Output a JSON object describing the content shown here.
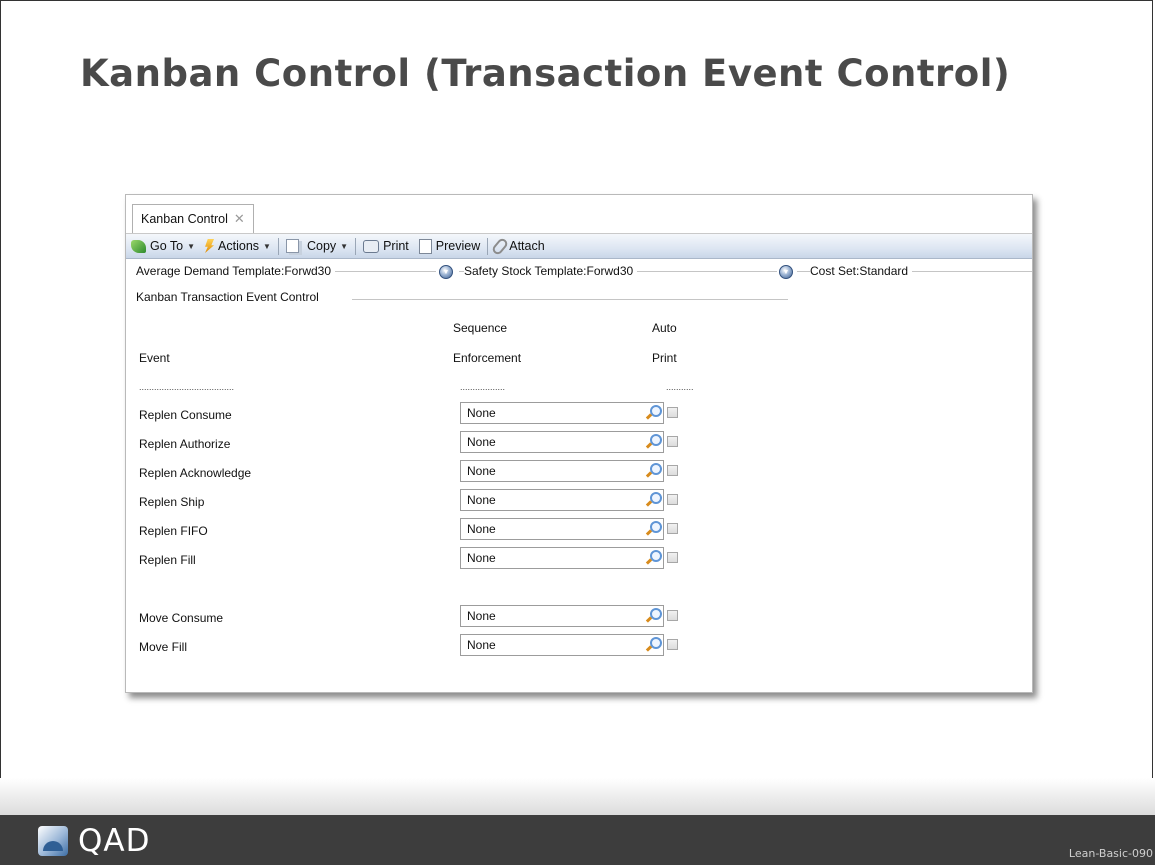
{
  "slide": {
    "title": "Kanban Control (Transaction Event Control)",
    "logo_text": "QAD",
    "slide_code": "Lean-Basic-090"
  },
  "window": {
    "tab_label": "Kanban Control",
    "tab_close_icon": "close-icon"
  },
  "toolbar": {
    "goto_label": "Go To",
    "actions_label": "Actions",
    "copy_label": "Copy",
    "print_label": "Print",
    "preview_label": "Preview",
    "attach_label": "Attach"
  },
  "header_groups": {
    "average_demand": "Average Demand Template:Forwd30",
    "safety_stock": "Safety Stock Template:Forwd30",
    "cost_set": "Cost Set:Standard"
  },
  "section": {
    "title": "Kanban Transaction Event Control"
  },
  "columns": {
    "event": "Event",
    "sequence_line1": "Sequence",
    "sequence_line2": "Enforcement",
    "auto_line1": "Auto",
    "auto_line2": "Print",
    "event_dots": "......................................",
    "sequence_dots": "..................",
    "auto_dots": "..........."
  },
  "rows": [
    {
      "label": "Replen Consume",
      "value": "None",
      "auto_print": false
    },
    {
      "label": "Replen Authorize",
      "value": "None",
      "auto_print": false
    },
    {
      "label": "Replen Acknowledge",
      "value": "None",
      "auto_print": false
    },
    {
      "label": "Replen Ship",
      "value": "None",
      "auto_print": false
    },
    {
      "label": "Replen FIFO",
      "value": "None",
      "auto_print": false
    },
    {
      "label": "Replen Fill",
      "value": "None",
      "auto_print": false
    },
    {
      "label": "Move Consume",
      "value": "None",
      "auto_print": false
    },
    {
      "label": "Move Fill",
      "value": "None",
      "auto_print": false
    }
  ]
}
